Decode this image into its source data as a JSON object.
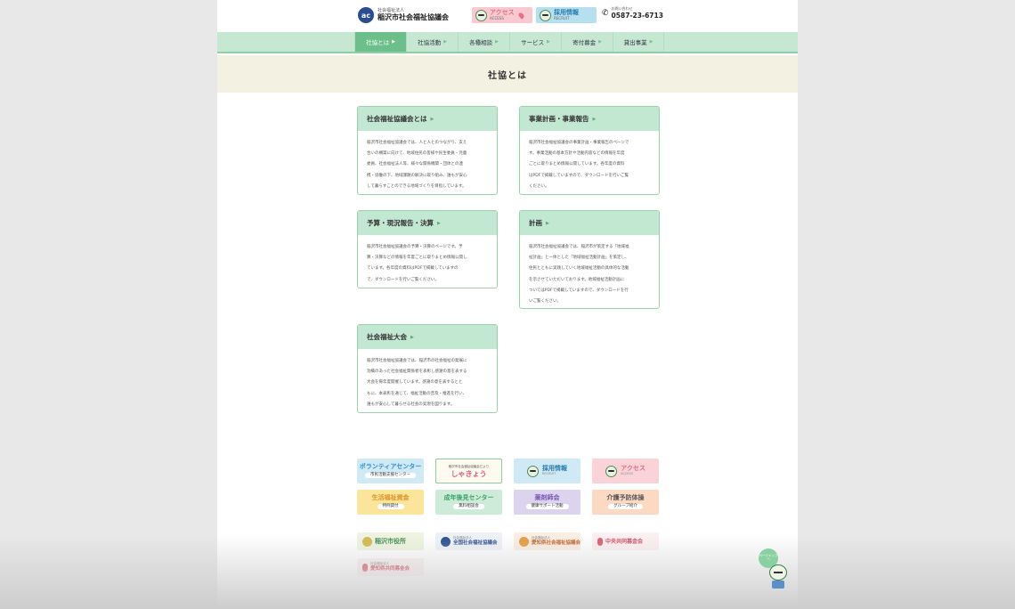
{
  "header": {
    "logo_mark": "ac",
    "logo_sub": "社会福祉法人",
    "logo_main": "稲沢市社会福祉協議会",
    "access_label": "アクセス",
    "access_en": "ACCESS",
    "recruit_label": "採用情報",
    "recruit_en": "RECRUIT",
    "phone_label": "お問い合わせ",
    "phone_number": "0587-23-6713"
  },
  "nav": {
    "items": [
      {
        "label": "社協とは",
        "active": true
      },
      {
        "label": "社協活動"
      },
      {
        "label": "各種相談"
      },
      {
        "label": "サービス"
      },
      {
        "label": "寄付募金"
      },
      {
        "label": "貸出事業"
      }
    ]
  },
  "page_title": "社協とは",
  "cards": [
    {
      "title": "社会福祉協議会とは",
      "lines": [
        "稲沢市社会福祉協議会では、人と人とのつながり、支え",
        "合いの構築に向けて、地域住民の皆様や民生委員・児童",
        "委員、社会福祉法人等、様々な関係機関・団体との連",
        "携・協働の下、地域課題の解決に取り組み、誰もが安心",
        "して暮らすことのできる地域づくりを目指しています。"
      ]
    },
    {
      "title": "事業計画・事業報告",
      "lines": [
        "稲沢市社会福祉協議会の事業計画・事業報告のページで",
        "す。事業活動の基本方針や活動内容などの情報を年度",
        "ごとに取りまとめ情報公開しています。各年度の資料",
        "はPDFで掲載していますので、ダウンロードを行いご覧",
        "ください。"
      ]
    },
    {
      "title": "予算・現況報告・決算",
      "lines": [
        "稲沢市社会福祉協議会の予算・決算のページです。予",
        "算・決算などの情報を年度ごとに取りまとめ情報公開し",
        "ています。各年度の資料はPDFで掲載していますの",
        "で、ダウンロードを行いご覧ください。"
      ]
    },
    {
      "title": "計画",
      "lines": [
        "稲沢市社会福祉協議会では、稲沢市が策定する「地域福",
        "祉計画」と一体とした「地域福祉活動計画」を策定し、",
        "住民とともに実践していく地域福祉活動の具体的な活動",
        "を示させていただいております。地域福祉活動計画に",
        "ついてはPDFで掲載していますので、ダウンロードを行",
        "いご覧ください。"
      ]
    },
    {
      "title": "社会福祉大会",
      "lines": [
        "稲沢市社会福祉協議会では、稲沢市の社会福祉の発展に",
        "功績のあった社会福祉関係者を表彰し感謝の意を表する",
        "大会を毎年度開催しています。感謝の意を表するとと",
        "もに、本表彰を通じて、福祉活動の普及・推進を行い、",
        "誰もが安心して暮らせる社会の実現を図ります。"
      ]
    }
  ],
  "banners": {
    "volunteer": {
      "main": "ボランティアセンター",
      "sub": "市民活動支援センター"
    },
    "koho": {
      "top": "稲沢市社会福祉協議会だより",
      "main": "しゃきょう"
    },
    "recruit": {
      "main": "採用情報",
      "en": "RECRUIT"
    },
    "access": {
      "main": "アクセス",
      "en": "ACCESS"
    },
    "seikatsu": {
      "main": "生活福祉資金",
      "sub": "特例貸付"
    },
    "seinen": {
      "main": "成年後見センター",
      "sub": "無料相談会"
    },
    "yakuzai": {
      "main": "薬剤師会",
      "sub": "健康サポート活動"
    },
    "kaigo": {
      "main": "介護予防体操",
      "sub": "グループ紹介"
    }
  },
  "links": [
    {
      "sub": "",
      "main": "稲沢市役所"
    },
    {
      "sub": "社会福祉法人",
      "main": "全国社会福祉協議会"
    },
    {
      "sub": "社会福祉法人",
      "main": "愛知県社会福祉協議会"
    },
    {
      "sub": "",
      "main": "中央共同募金会"
    },
    {
      "sub": "社会福祉法人",
      "main": "愛知県共同募金会"
    }
  ],
  "mascot_bubble": "ページトップへ",
  "colors": {
    "nav_bg": "#c6e8d2",
    "nav_active": "#6cbf8a",
    "card_border": "#98d3ad",
    "card_head": "#c3e8d2",
    "title_band": "#f3f1e2"
  }
}
